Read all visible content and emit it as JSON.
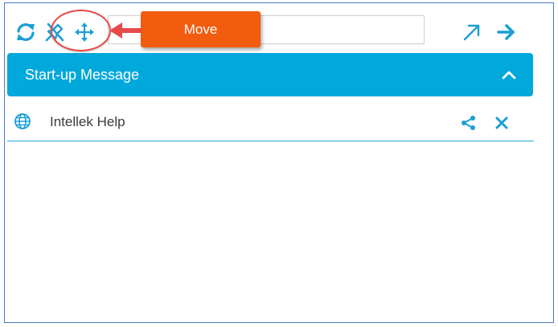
{
  "toolbar": {
    "search_value": "",
    "icons": [
      "refresh-icon",
      "unpin-icon",
      "move-icon",
      "open-external-icon",
      "forward-arrow-icon"
    ]
  },
  "callout": {
    "label": "Move",
    "color": "#f25c0f",
    "highlight_color": "#e84a4a"
  },
  "panel": {
    "header_title": "Start-up Message",
    "header_color": "#00a8dc",
    "collapse_icon": "chevron-up-icon"
  },
  "help_item": {
    "label": "Intellek Help",
    "icon": "globe-icon",
    "actions": [
      "share-icon",
      "close-icon"
    ]
  },
  "colors": {
    "accent": "#1a9fd6",
    "frame_border": "#4a7ab8"
  }
}
